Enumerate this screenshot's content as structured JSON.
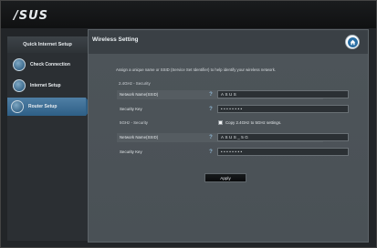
{
  "brand": {
    "logo": "/SUS"
  },
  "sidebar": {
    "title": "Quick Internet Setup",
    "steps": [
      {
        "label": "Check Connection"
      },
      {
        "label": "Internet Setup"
      },
      {
        "label": "Router Setup"
      }
    ]
  },
  "main": {
    "title": "Wireless Setting",
    "instruction": "Assign a unique name or SSID (Service Set Identifier) to help identify your wireless network.",
    "band24": {
      "heading": "2.4GHz - Security",
      "ssid_label": "Network Name(SSID)",
      "ssid_value": "ASUS",
      "key_label": "Security Key",
      "key_value": "••••••••"
    },
    "band5": {
      "heading": "5GHz - Security",
      "copy_label": "Copy 2.4GHz to 5GHz settings.",
      "ssid_label": "Network Name(SSID)",
      "ssid_value": "ASUS_5G",
      "key_label": "Security Key",
      "key_value": "••••••••"
    },
    "help_glyph": "?",
    "apply_label": "Apply"
  }
}
